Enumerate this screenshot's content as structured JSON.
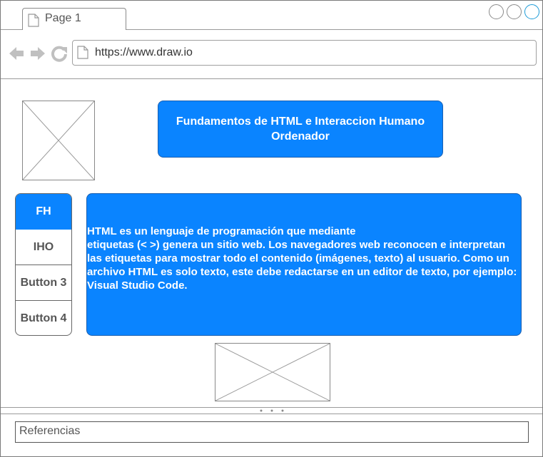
{
  "browser": {
    "tab_label": "Page 1",
    "url": "https://www.draw.io",
    "icons": {
      "tab": "page-icon",
      "back": "arrow-left-icon",
      "forward": "arrow-right-icon",
      "reload": "reload-icon",
      "address": "page-icon"
    }
  },
  "header": {
    "title": "Fundamentos de HTML e Interaccion Humano Ordenador"
  },
  "nav": {
    "items": [
      {
        "label": "FH",
        "active": true
      },
      {
        "label": "IHO",
        "active": false
      },
      {
        "label": "Button 3",
        "active": false
      },
      {
        "label": "Button 4",
        "active": false
      }
    ]
  },
  "content": {
    "text": "HTML es un lenguaje de programación que mediante\netiquetas (< >) genera un sitio web. Los navegadores web reconocen e interpretan las etiquetas para mostrar todo el contenido (imágenes, texto) al usuario. Como un archivo HTML es solo texto, este debe redactarse en un editor de texto, por ejemplo: Visual Studio Code."
  },
  "footer": {
    "references_label": "Referencias"
  },
  "colors": {
    "accent": "#0a84ff",
    "close_button": "#1c9bd8"
  }
}
